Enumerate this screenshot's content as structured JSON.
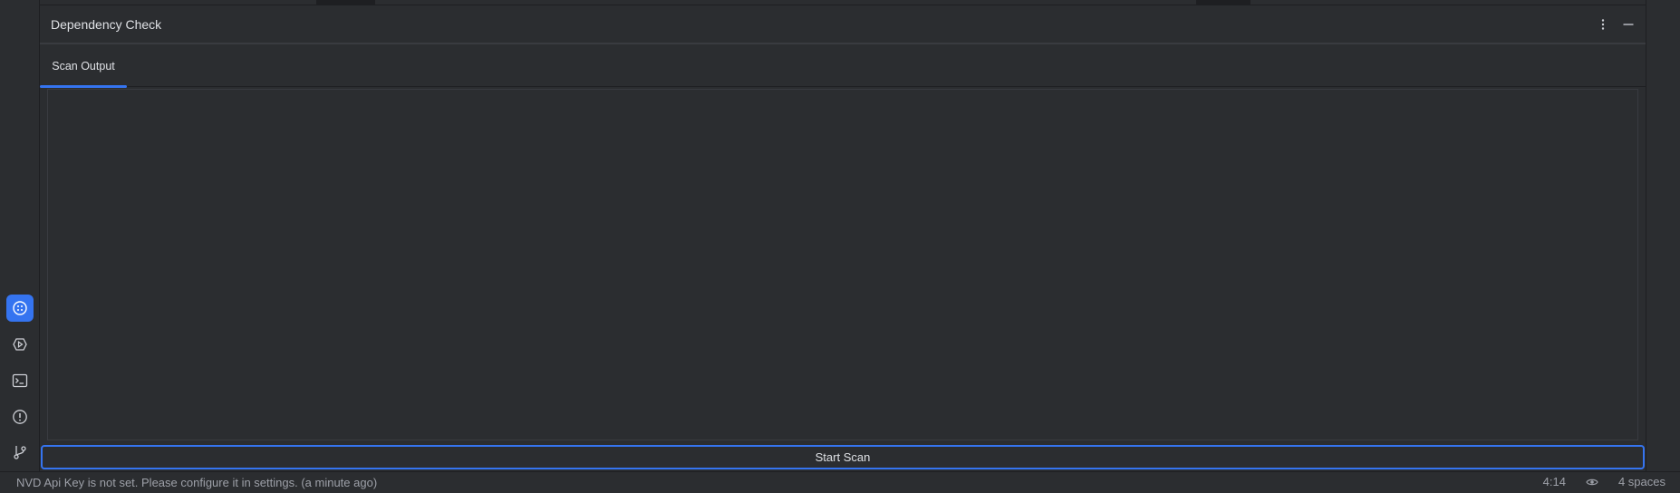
{
  "toolwindow": {
    "title": "Dependency Check",
    "more_icon": "more-vertical-icon",
    "minimize_icon": "minimize-icon",
    "tabs": [
      {
        "label": "Scan Output",
        "active": true
      }
    ],
    "output_text": "",
    "start_button_label": "Start Scan"
  },
  "stripe": {
    "items": [
      {
        "name": "dependency-check-icon",
        "active": true
      },
      {
        "name": "run-icon",
        "active": false
      },
      {
        "name": "terminal-icon",
        "active": false
      },
      {
        "name": "problems-icon",
        "active": false
      },
      {
        "name": "git-icon",
        "active": false
      }
    ]
  },
  "statusbar": {
    "message": "NVD Api Key is not set. Please configure it in settings. (a minute ago)",
    "position": "4:14",
    "indent": "4 spaces",
    "eye_icon": "eye-icon"
  },
  "colors": {
    "accent": "#3574f0",
    "background": "#2b2d30",
    "border": "#1e1f22"
  }
}
